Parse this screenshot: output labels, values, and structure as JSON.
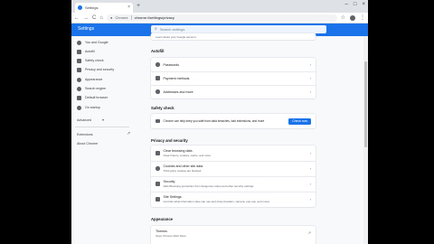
{
  "browser": {
    "tab_title": "Settings",
    "tab_close": "×",
    "new_tab": "+",
    "window_controls": [
      "–",
      "□",
      "×"
    ],
    "nav": {
      "back": "←",
      "forward": "→",
      "reload": "C",
      "home": "⌂"
    },
    "url_host": "Chrome",
    "url_path": "chrome://settings/privacy",
    "star": "☆",
    "menu": "⋮"
  },
  "header": {
    "title": "Settings",
    "search_placeholder": "Search settings"
  },
  "sidebar": {
    "items": [
      {
        "label": "You and Google",
        "icon": "person-icon"
      },
      {
        "label": "Autofill",
        "icon": "autofill-icon"
      },
      {
        "label": "Safety check",
        "icon": "shield-icon"
      },
      {
        "label": "Privacy and security",
        "icon": "privacy-shield-icon"
      },
      {
        "label": "Appearance",
        "icon": "palette-icon"
      },
      {
        "label": "Search engine",
        "icon": "search-icon"
      },
      {
        "label": "Default browser",
        "icon": "browser-icon"
      },
      {
        "label": "On startup",
        "icon": "power-icon"
      }
    ],
    "advanced": "Advanced",
    "advanced_chevron": "▾",
    "extensions": "Extensions",
    "extensions_link": "↗",
    "about": "About Chrome"
  },
  "main": {
    "top_partial_row": "Learn about your Google account",
    "autofill": {
      "title": "Autofill",
      "rows": [
        {
          "label": "Passwords",
          "icon": "key-icon"
        },
        {
          "label": "Payment methods",
          "icon": "card-icon"
        },
        {
          "label": "Addresses and more",
          "icon": "location-icon"
        }
      ]
    },
    "safety": {
      "title": "Safety check",
      "text": "Chrome can help keep you safe from data breaches, bad extensions, and more",
      "button": "Check now"
    },
    "privacy": {
      "title": "Privacy and security",
      "rows": [
        {
          "label": "Clear browsing data",
          "sub": "Clear history, cookies, cache, and more",
          "icon": "trash-icon"
        },
        {
          "label": "Cookies and other site data",
          "sub": "Third-party cookies are blocked",
          "icon": "cookie-icon"
        },
        {
          "label": "Security",
          "sub": "Safe Browsing (protection from dangerous sites) and other security settings",
          "icon": "security-shield-icon"
        },
        {
          "label": "Site Settings",
          "sub": "Controls what information sites can use and show (location, camera, pop-ups, and more)",
          "icon": "sliders-icon"
        }
      ]
    },
    "appearance": {
      "title": "Appearance",
      "rows": [
        {
          "label": "Themes",
          "sub": "Open Chrome Web Store"
        }
      ]
    },
    "arrow": "›",
    "external": "↗"
  }
}
